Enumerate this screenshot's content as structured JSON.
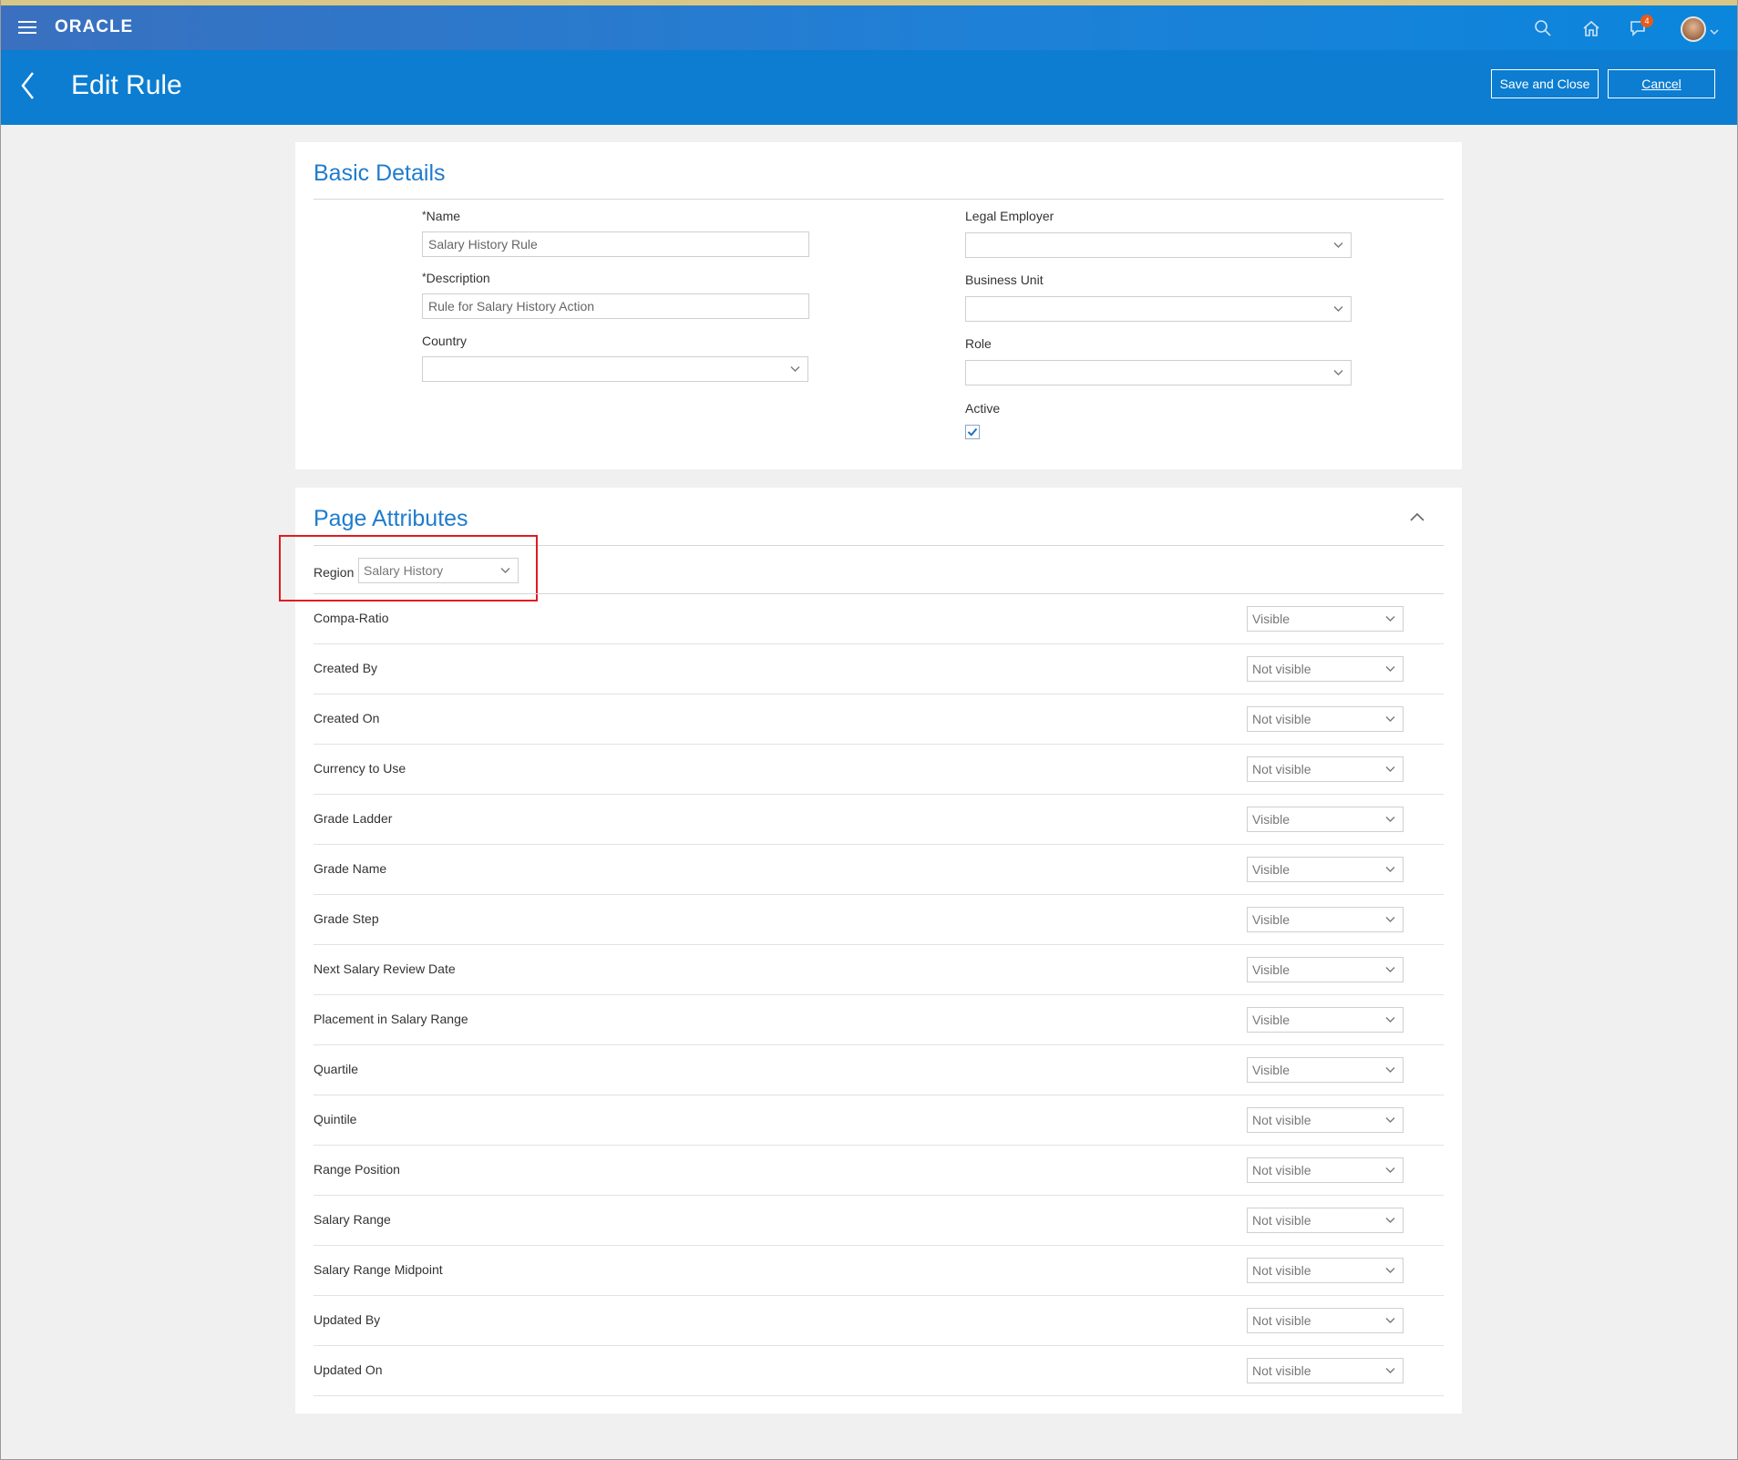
{
  "app": {
    "logo": "ORACLE",
    "notification_count": "4"
  },
  "header": {
    "title": "Edit Rule",
    "save_label": "Save and Close",
    "cancel_label": "Cancel"
  },
  "basic_details": {
    "title": "Basic Details",
    "name": {
      "label": "Name",
      "required_mark": "*",
      "value": "Salary History Rule"
    },
    "description": {
      "label": "Description",
      "required_mark": "*",
      "value": "Rule for Salary History Action"
    },
    "country": {
      "label": "Country",
      "value": ""
    },
    "legal_employer": {
      "label": "Legal Employer",
      "value": ""
    },
    "business_unit": {
      "label": "Business Unit",
      "value": ""
    },
    "role": {
      "label": "Role",
      "value": ""
    },
    "active": {
      "label": "Active",
      "checked": true
    }
  },
  "page_attributes": {
    "title": "Page Attributes",
    "region": {
      "label": "Region",
      "value": "Salary History"
    },
    "rows": [
      {
        "label": "Compa-Ratio",
        "value": "Visible"
      },
      {
        "label": "Created By",
        "value": "Not visible"
      },
      {
        "label": "Created On",
        "value": "Not visible"
      },
      {
        "label": "Currency to Use",
        "value": "Not visible"
      },
      {
        "label": "Grade Ladder",
        "value": "Visible"
      },
      {
        "label": "Grade Name",
        "value": "Visible"
      },
      {
        "label": "Grade Step",
        "value": "Visible"
      },
      {
        "label": "Next Salary Review Date",
        "value": "Visible"
      },
      {
        "label": "Placement in Salary Range",
        "value": "Visible"
      },
      {
        "label": "Quartile",
        "value": "Visible"
      },
      {
        "label": "Quintile",
        "value": "Not visible"
      },
      {
        "label": "Range Position",
        "value": "Not visible"
      },
      {
        "label": "Salary Range",
        "value": "Not visible"
      },
      {
        "label": "Salary Range Midpoint",
        "value": "Not visible"
      },
      {
        "label": "Updated By",
        "value": "Not visible"
      },
      {
        "label": "Updated On",
        "value": "Not visible"
      }
    ]
  },
  "colors": {
    "brand_blue": "#0c7dd1",
    "link_blue": "#1f7ccd",
    "highlight_red": "#e11b22"
  }
}
